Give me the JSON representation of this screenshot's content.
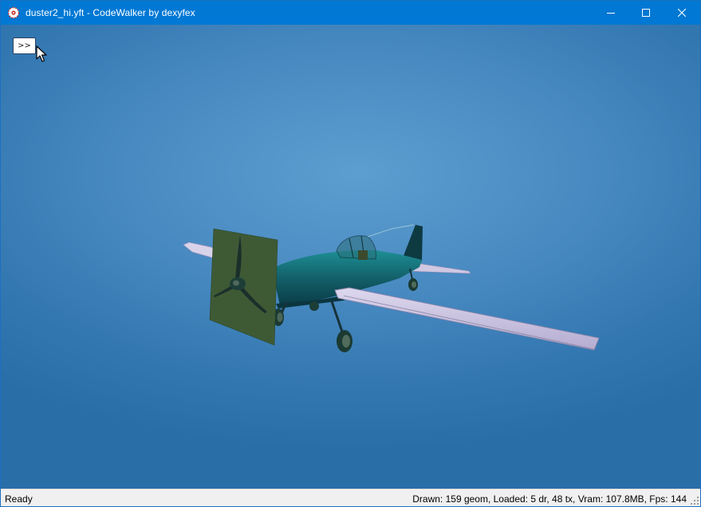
{
  "window": {
    "title": "duster2_hi.yft - CodeWalker by dexyfex",
    "app_icon": "codewalker-app-icon",
    "controls": [
      "minimize-icon",
      "maximize-icon",
      "close-icon"
    ],
    "titlebar_color": "#0078d4"
  },
  "viewport": {
    "toggle_label": ">>",
    "background_color": "#4a8bc2",
    "model": "crop-duster-airplane-icon"
  },
  "statusbar": {
    "status": "Ready",
    "stats": "Drawn: 159 geom, Loaded: 5 dr, 48 tx, Vram: 107.8MB, Fps: 144"
  }
}
